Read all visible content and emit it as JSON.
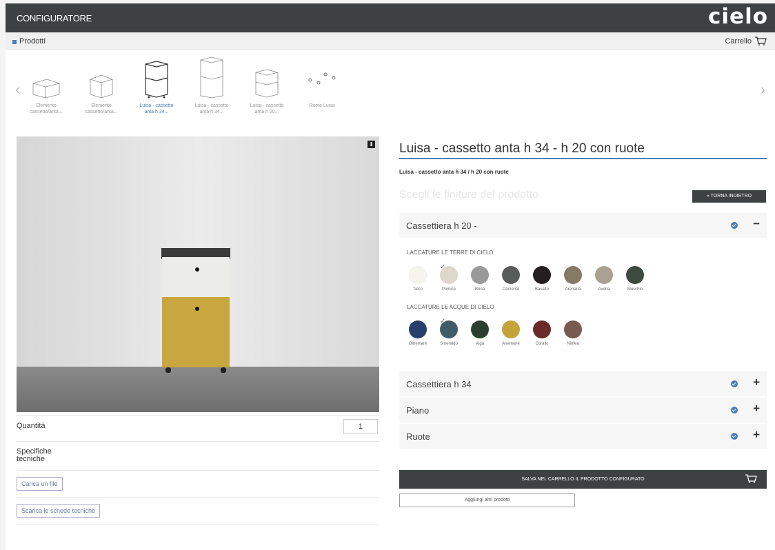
{
  "header": {
    "title": "CONFIGURATORE",
    "logo": "cielo"
  },
  "subheader": {
    "products": "Prodotti",
    "cart": "Carrello"
  },
  "carousel": {
    "items": [
      {
        "label1": "Elemento",
        "label2": "cassetto/anta..."
      },
      {
        "label1": "Elemento",
        "label2": "cassetto/anta..."
      },
      {
        "label1": "Luisa - cassetto",
        "label2": "anta h 34..."
      },
      {
        "label1": "Luisa - cassetto",
        "label2": "anta h 34..."
      },
      {
        "label1": "Luisa - cassetto",
        "label2": "anta h 20..."
      },
      {
        "label1": "Ruote Luisa",
        "label2": ""
      }
    ]
  },
  "left": {
    "quantity_label": "Quantità",
    "quantity_value": "1",
    "spec_line1": "Specifiche",
    "spec_line2": "tecniche",
    "upload_button": "Carica un file",
    "download_button": "Scarica le schede tecniche"
  },
  "product": {
    "title": "Luisa - cassetto anta h 34 - h 20 con ruote",
    "subtitle": "Luisa - cassetto anta h 34 / h 20 con ruote",
    "choose": "Scegli le finiture del prodotto",
    "back_button": "« TORNA INDIETRO"
  },
  "accordion": {
    "open": {
      "title": "Cassettiera h 20 -",
      "toggle": "−"
    },
    "closed": [
      {
        "title": "Cassettiera h 34",
        "toggle": "+"
      },
      {
        "title": "Piano",
        "toggle": "+"
      },
      {
        "title": "Ruote",
        "toggle": "+"
      }
    ]
  },
  "finishes": {
    "group1": {
      "title": "LACCATURE LE TERRE DI CIELO",
      "swatches": [
        {
          "name": "Talco",
          "color": "#f6f4ef"
        },
        {
          "name": "Pomice",
          "color": "#ddd8cc",
          "selected": true
        },
        {
          "name": "Brina",
          "color": "#9a9a9a"
        },
        {
          "name": "Cemento",
          "color": "#5a5c5b"
        },
        {
          "name": "Basalto",
          "color": "#231f20"
        },
        {
          "name": "Arenaria",
          "color": "#857a66"
        },
        {
          "name": "Avena",
          "color": "#a9a192"
        },
        {
          "name": "Muschio",
          "color": "#3e4a3f"
        }
      ]
    },
    "group2": {
      "title": "LACCATURE LE ACQUE DI CIELO",
      "swatches": [
        {
          "name": "Oltremare",
          "color": "#273f6b"
        },
        {
          "name": "Smeraldo",
          "color": "#3f5d66",
          "selected": true
        },
        {
          "name": "Alga",
          "color": "#2c3f2e"
        },
        {
          "name": "Anemone",
          "color": "#c4a33a"
        },
        {
          "name": "Corallo",
          "color": "#6b2a2a"
        },
        {
          "name": "Ninfea",
          "color": "#7a5a50"
        }
      ]
    }
  },
  "actions": {
    "save": "SALVA NEL CARRELLO IL PRODOTTO CONFIGURATO",
    "add": "Aggiungi altri prodotti"
  },
  "colors": {
    "dark": "#3d4141",
    "accent": "#4a7fb5"
  }
}
